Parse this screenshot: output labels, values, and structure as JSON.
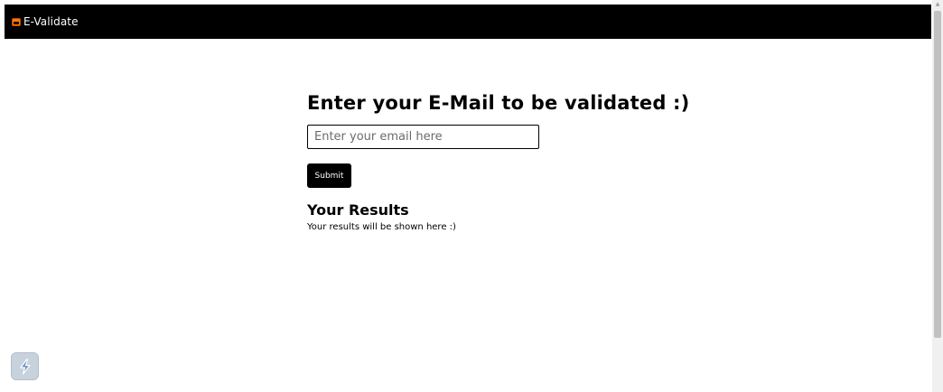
{
  "navbar": {
    "brand_icon": "tv-icon",
    "brand_text": "E-Validate"
  },
  "main": {
    "headline": "Enter your E-Mail to be validated :)",
    "email_input": {
      "value": "",
      "placeholder": "Enter your email here"
    },
    "submit_label": "Submit",
    "results_heading": "Your Results",
    "results_text": "Your results will be shown here :)"
  },
  "floating_widget": {
    "icon": "lightning-bolt-icon"
  },
  "colors": {
    "navbar_background": "#000000",
    "brand_icon_orange": "#ff7a00",
    "button_background": "#000000",
    "widget_background": "#c8d2dc",
    "widget_bolt": "#6f93cf"
  }
}
